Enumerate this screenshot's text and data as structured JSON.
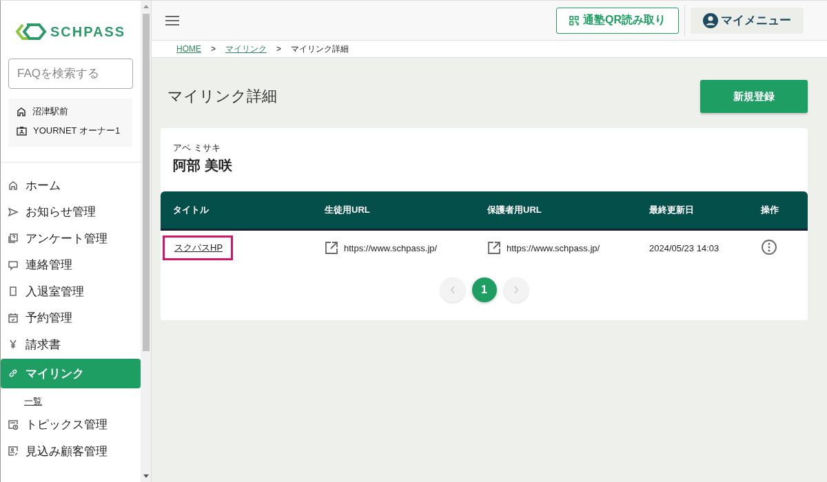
{
  "logo": {
    "text": "SCHPASS"
  },
  "search": {
    "placeholder": "FAQを検索する"
  },
  "account": {
    "school": "沼津駅前",
    "user": "YOURNET オーナー1"
  },
  "nav": [
    {
      "label": "ホーム",
      "kind": "home",
      "selected": false
    },
    {
      "label": "お知らせ管理",
      "kind": "send",
      "selected": false
    },
    {
      "label": "アンケート管理",
      "kind": "survey",
      "selected": false
    },
    {
      "label": "連絡管理",
      "kind": "chat",
      "selected": false
    },
    {
      "label": "入退室管理",
      "kind": "door",
      "selected": false
    },
    {
      "label": "予約管理",
      "kind": "calendar",
      "selected": false
    },
    {
      "label": "請求書",
      "kind": "yen",
      "selected": false
    },
    {
      "label": "マイリンク",
      "kind": "link",
      "selected": true,
      "children": [
        {
          "label": "一覧"
        }
      ]
    },
    {
      "label": "トピックス管理",
      "kind": "topics",
      "selected": false
    },
    {
      "label": "見込み顧客管理",
      "kind": "prospect",
      "selected": false
    }
  ],
  "topbar": {
    "qr_button": "通塾QR読み取り",
    "menu_button": "マイメニュー"
  },
  "breadcrumb": [
    {
      "label": "HOME",
      "link": true
    },
    {
      "label": "マイリンク",
      "link": true
    },
    {
      "label": "マイリンク詳細",
      "link": false
    }
  ],
  "breadcrumb_separator": ">",
  "page_title": "マイリンク詳細",
  "new_button": "新規登録",
  "student": {
    "kana": "アベ ミサキ",
    "name": "阿部 美咲"
  },
  "table": {
    "columns": [
      "タイトル",
      "生徒用URL",
      "保護者用URL",
      "最終更新日",
      "操作"
    ],
    "rows": [
      {
        "title": "スクパスHP",
        "highlighted": true,
        "student_url": "https://www.schpass.jp/",
        "parent_url": "https://www.schpass.jp/",
        "updated": "2024/05/23 14:03"
      }
    ]
  },
  "pagination": {
    "pages": [
      {
        "label": "1",
        "selected": true
      }
    ],
    "prev_disabled": true,
    "next_disabled": true
  }
}
